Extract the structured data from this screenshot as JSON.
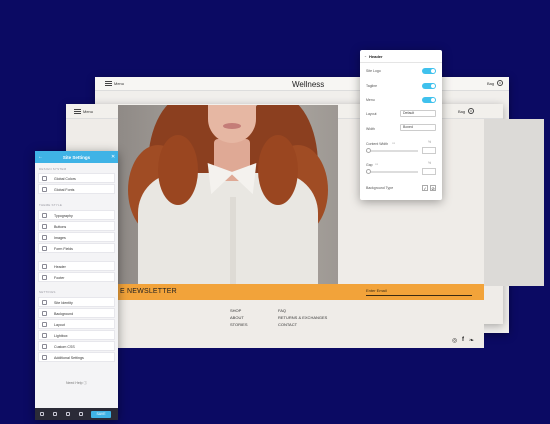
{
  "back_window": {
    "menu_label": "Menu",
    "brand": "Wellness",
    "bag_label": "Bag",
    "bag_count": "0"
  },
  "mid_window": {
    "menu_label": "Menu",
    "bag_label": "Bag",
    "bag_count": "0"
  },
  "newsletter": {
    "title": "E NEWSLETTER",
    "input_placeholder": "Enter Email"
  },
  "footer": {
    "col1": [
      "SHOP",
      "ABOUT",
      "STORIES"
    ],
    "col2": [
      "FAQ",
      "RETURNS & EXCHANGES",
      "CONTACT"
    ],
    "social_icons": [
      "instagram-icon",
      "facebook-icon",
      "twitter-icon"
    ]
  },
  "header_panel": {
    "title": "Header",
    "rows": {
      "site_logo": "Site Logo",
      "tagline": "Tagline",
      "menu": "Menu",
      "layout": "Layout",
      "layout_value": "Default",
      "width": "Width",
      "width_value": "Boxed",
      "content_width": "Content Width",
      "gap": "Gap",
      "background_type": "Background Type"
    },
    "toggles_on": [
      true,
      true,
      true
    ],
    "accent": "#3fc1ed"
  },
  "site_settings": {
    "title": "Site Settings",
    "sections": {
      "design_system": "DESIGN SYSTEM",
      "theme_style": "THEME STYLE",
      "settings": "SETTINGS"
    },
    "design_items": [
      "Global Colors",
      "Global Fonts"
    ],
    "theme_items": [
      "Typography",
      "Buttons",
      "Images",
      "Form Fields"
    ],
    "layout_items": [
      "Header",
      "Footer"
    ],
    "settings_items": [
      "Site Identity",
      "Background",
      "Layout",
      "Lightbox",
      "Custom CSS",
      "Additional Settings"
    ],
    "need_help": "Need Help",
    "save_label": "SAVE",
    "header_color": "#3fb3e6"
  },
  "colors": {
    "stage": "#0b0a63",
    "newsletter_bar": "#f2a33a"
  }
}
